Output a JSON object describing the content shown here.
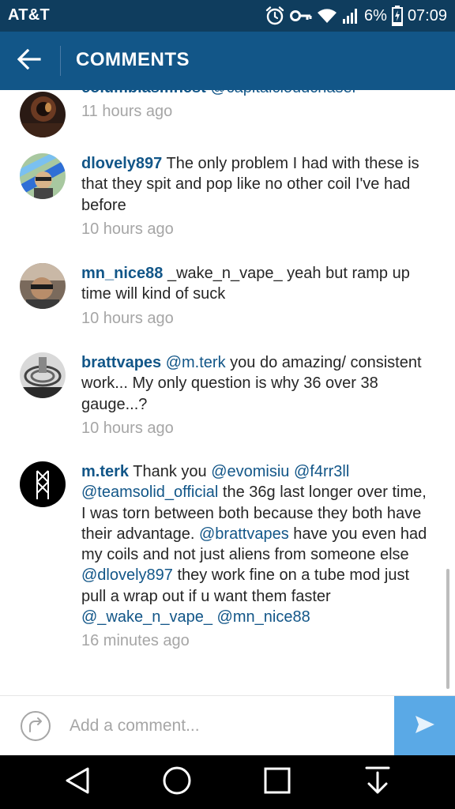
{
  "status_bar": {
    "carrier": "AT&T",
    "battery": "6%",
    "time": "07:09",
    "icons": [
      "alarm-icon",
      "key-icon",
      "wifi-icon",
      "signal-icon",
      "battery-charging-icon"
    ]
  },
  "header": {
    "title": "COMMENTS",
    "back_icon": "arrow-left-icon"
  },
  "comments": [
    {
      "username": "columbias.finest",
      "segments": [
        {
          "text": "@capitalcloudchaser",
          "mention": true
        }
      ],
      "time": "11 hours ago"
    },
    {
      "username": "dlovely897",
      "segments": [
        {
          "text": "The only problem I had with these is that they spit and pop like no other coil I've had before",
          "mention": false
        }
      ],
      "time": "10 hours ago"
    },
    {
      "username": "mn_nice88",
      "segments": [
        {
          "text": "_wake_n_vape_ yeah but ramp up time will kind of suck",
          "mention": false
        }
      ],
      "time": "10 hours ago"
    },
    {
      "username": "brattvapes",
      "segments": [
        {
          "text": "@m.terk",
          "mention": true
        },
        {
          "text": "you do amazing/ consistent work... My only question is why 36 over 38 gauge...?",
          "mention": false
        }
      ],
      "time": "10 hours ago"
    },
    {
      "username": "m.terk",
      "segments": [
        {
          "text": "Thank you",
          "mention": false
        },
        {
          "text": "@evomisiu",
          "mention": true
        },
        {
          "text": "@f4rr3ll",
          "mention": true
        },
        {
          "text": "@teamsolid_official",
          "mention": true
        },
        {
          "text": "the 36g last longer over time, I was torn between both because they both have their advantage.",
          "mention": false
        },
        {
          "text": "@brattvapes",
          "mention": true
        },
        {
          "text": "have you even had my coils and not just aliens from someone else",
          "mention": false
        },
        {
          "text": "@dlovely897",
          "mention": true
        },
        {
          "text": "they work fine on a tube mod just pull a wrap out if u want them faster",
          "mention": false
        },
        {
          "text": "@_wake_n_vape_",
          "mention": true
        },
        {
          "text": "@mn_nice88",
          "mention": true
        }
      ],
      "time": "16 minutes ago"
    }
  ],
  "composer": {
    "placeholder": "Add a comment...",
    "left_icon": "direct-arrow-icon",
    "send_icon": "send-icon"
  },
  "nav_bar": {
    "icons": [
      "back-triangle-icon",
      "home-circle-icon",
      "recents-square-icon",
      "download-icon"
    ]
  },
  "colors": {
    "status_bar": "#0f3d5e",
    "header": "#125688",
    "link": "#125688",
    "timestamp": "#a6a6a6",
    "send_button": "#5aa9e6"
  }
}
